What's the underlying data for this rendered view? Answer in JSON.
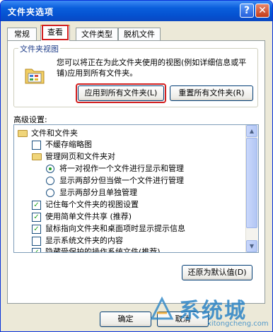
{
  "window": {
    "title": "文件夹选项",
    "help_glyph": "?",
    "close_glyph": "✕"
  },
  "tabs": [
    {
      "label": "常规",
      "active": false
    },
    {
      "label": "查看",
      "active": true
    },
    {
      "label": "文件类型",
      "active": false
    },
    {
      "label": "脱机文件",
      "active": false
    }
  ],
  "folder_views": {
    "title": "文件夹视图",
    "description": "您可以将正在为此文件夹使用的视图(例如详细信息或平铺)应用到所有文件夹。",
    "apply_button": "应用到所有文件夹(L)",
    "reset_button": "重置所有文件夹(R)"
  },
  "advanced": {
    "label": "高级设置:",
    "items": [
      {
        "type": "folder",
        "label": "文件和文件夹"
      },
      {
        "type": "checkbox",
        "checked": false,
        "label": "不缓存缩略图"
      },
      {
        "type": "folder",
        "label": "管理网页和文件夹对"
      },
      {
        "type": "radio",
        "checked": true,
        "label": "将一对视作一个文件进行显示和管理"
      },
      {
        "type": "radio",
        "checked": false,
        "label": "显示两部分但当做一个文件进行管理"
      },
      {
        "type": "radio",
        "checked": false,
        "label": "显示两部分且单独管理"
      },
      {
        "type": "checkbox",
        "checked": true,
        "label": "记住每个文件夹的视图设置"
      },
      {
        "type": "checkbox",
        "checked": true,
        "label": "使用简单文件共享 (推荐)"
      },
      {
        "type": "checkbox",
        "checked": true,
        "label": "鼠标指向文件夹和桌面项时显示提示信息"
      },
      {
        "type": "checkbox",
        "checked": false,
        "label": "显示系统文件夹的内容"
      },
      {
        "type": "checkbox",
        "checked": true,
        "label": "隐藏受保护的操作系统文件(推荐)"
      }
    ],
    "restore_button": "还原为默认值(D)"
  },
  "dialog_buttons": {
    "ok": "确定",
    "cancel": "取消"
  },
  "watermark": {
    "main": "系统城",
    "sub": "xitongcheng.com"
  },
  "colors": {
    "title_bar": "#0a5fdc",
    "highlight_box": "#d21f1f",
    "check": "#21a121"
  }
}
